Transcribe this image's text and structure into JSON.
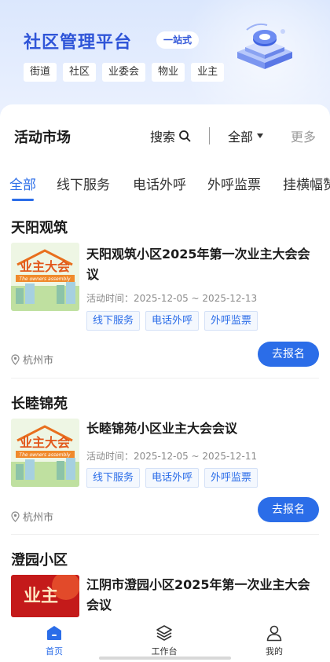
{
  "banner": {
    "title": "社区管理平台",
    "badge": "一站式",
    "chips": [
      "街道",
      "社区",
      "业委会",
      "物业",
      "业主"
    ]
  },
  "header": {
    "title": "活动市场",
    "search_label": "搜索",
    "filter_label": "全部",
    "more_label": "更多"
  },
  "tabs": [
    "全部",
    "线下服务",
    "电话外呼",
    "外呼监票",
    "挂横幅赞"
  ],
  "activities": [
    {
      "group": "天阳观筑",
      "title": "天阳观筑小区2025年第一次业主大会会议",
      "time": "活动时间：2025-12-05 ~ 2025-12-13",
      "tags": [
        "线下服务",
        "电话外呼",
        "外呼监票"
      ],
      "location": "杭州市",
      "action": "去报名",
      "thumb_text": "业主大会",
      "thumb_subtext": "The owners assembly"
    },
    {
      "group": "长睦锦苑",
      "title": "长睦锦苑小区业主大会会议",
      "time": "活动时间：2025-12-05 ~ 2025-12-11",
      "tags": [
        "线下服务",
        "电话外呼",
        "外呼监票"
      ],
      "location": "杭州市",
      "action": "去报名",
      "thumb_text": "业主大会",
      "thumb_subtext": "The owners assembly"
    },
    {
      "group": "澄园小区",
      "title": "江阴市澄园小区2025年第一次业主大会会议",
      "thumb_text": "业主"
    }
  ],
  "bottom_nav": [
    {
      "label": "首页",
      "icon": "home-icon"
    },
    {
      "label": "工作台",
      "icon": "layers-icon"
    },
    {
      "label": "我的",
      "icon": "user-icon"
    }
  ],
  "colors": {
    "accent": "#2b6de8",
    "banner_title": "#2f55d8"
  }
}
